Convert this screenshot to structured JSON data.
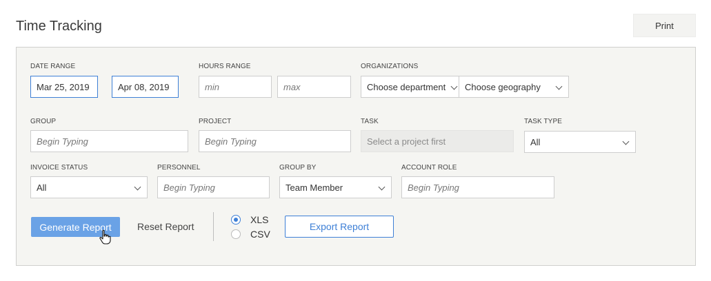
{
  "header": {
    "title": "Time Tracking",
    "print_label": "Print"
  },
  "filters": {
    "date_range": {
      "label": "DATE RANGE",
      "start": "Mar 25, 2019",
      "end": "Apr 08, 2019"
    },
    "hours_range": {
      "label": "HOURS RANGE",
      "min_placeholder": "min",
      "max_placeholder": "max"
    },
    "organizations": {
      "label": "ORGANIZATIONS",
      "department": "Choose department",
      "geography": "Choose geography"
    },
    "group": {
      "label": "GROUP",
      "placeholder": "Begin Typing"
    },
    "project": {
      "label": "PROJECT",
      "placeholder": "Begin Typing"
    },
    "task": {
      "label": "TASK",
      "placeholder": "Select a project first"
    },
    "task_type": {
      "label": "TASK TYPE",
      "value": "All"
    },
    "invoice_status": {
      "label": "INVOICE STATUS",
      "value": "All"
    },
    "personnel": {
      "label": "PERSONNEL",
      "placeholder": "Begin Typing"
    },
    "group_by": {
      "label": "GROUP BY",
      "value": "Team Member"
    },
    "account_role": {
      "label": "ACCOUNT ROLE",
      "placeholder": "Begin Typing"
    }
  },
  "actions": {
    "generate_label": "Generate Report",
    "reset_label": "Reset Report",
    "format_options": [
      {
        "label": "XLS",
        "checked": true
      },
      {
        "label": "CSV",
        "checked": false
      }
    ],
    "export_label": "Export Report"
  },
  "colors": {
    "accent": "#3d7fd6",
    "generate_button": "#6aa2e6",
    "panel_background": "#f5f5f2"
  },
  "icons": {
    "select_caret": "chevron-down-icon",
    "pointer": "hand-pointer-icon"
  }
}
